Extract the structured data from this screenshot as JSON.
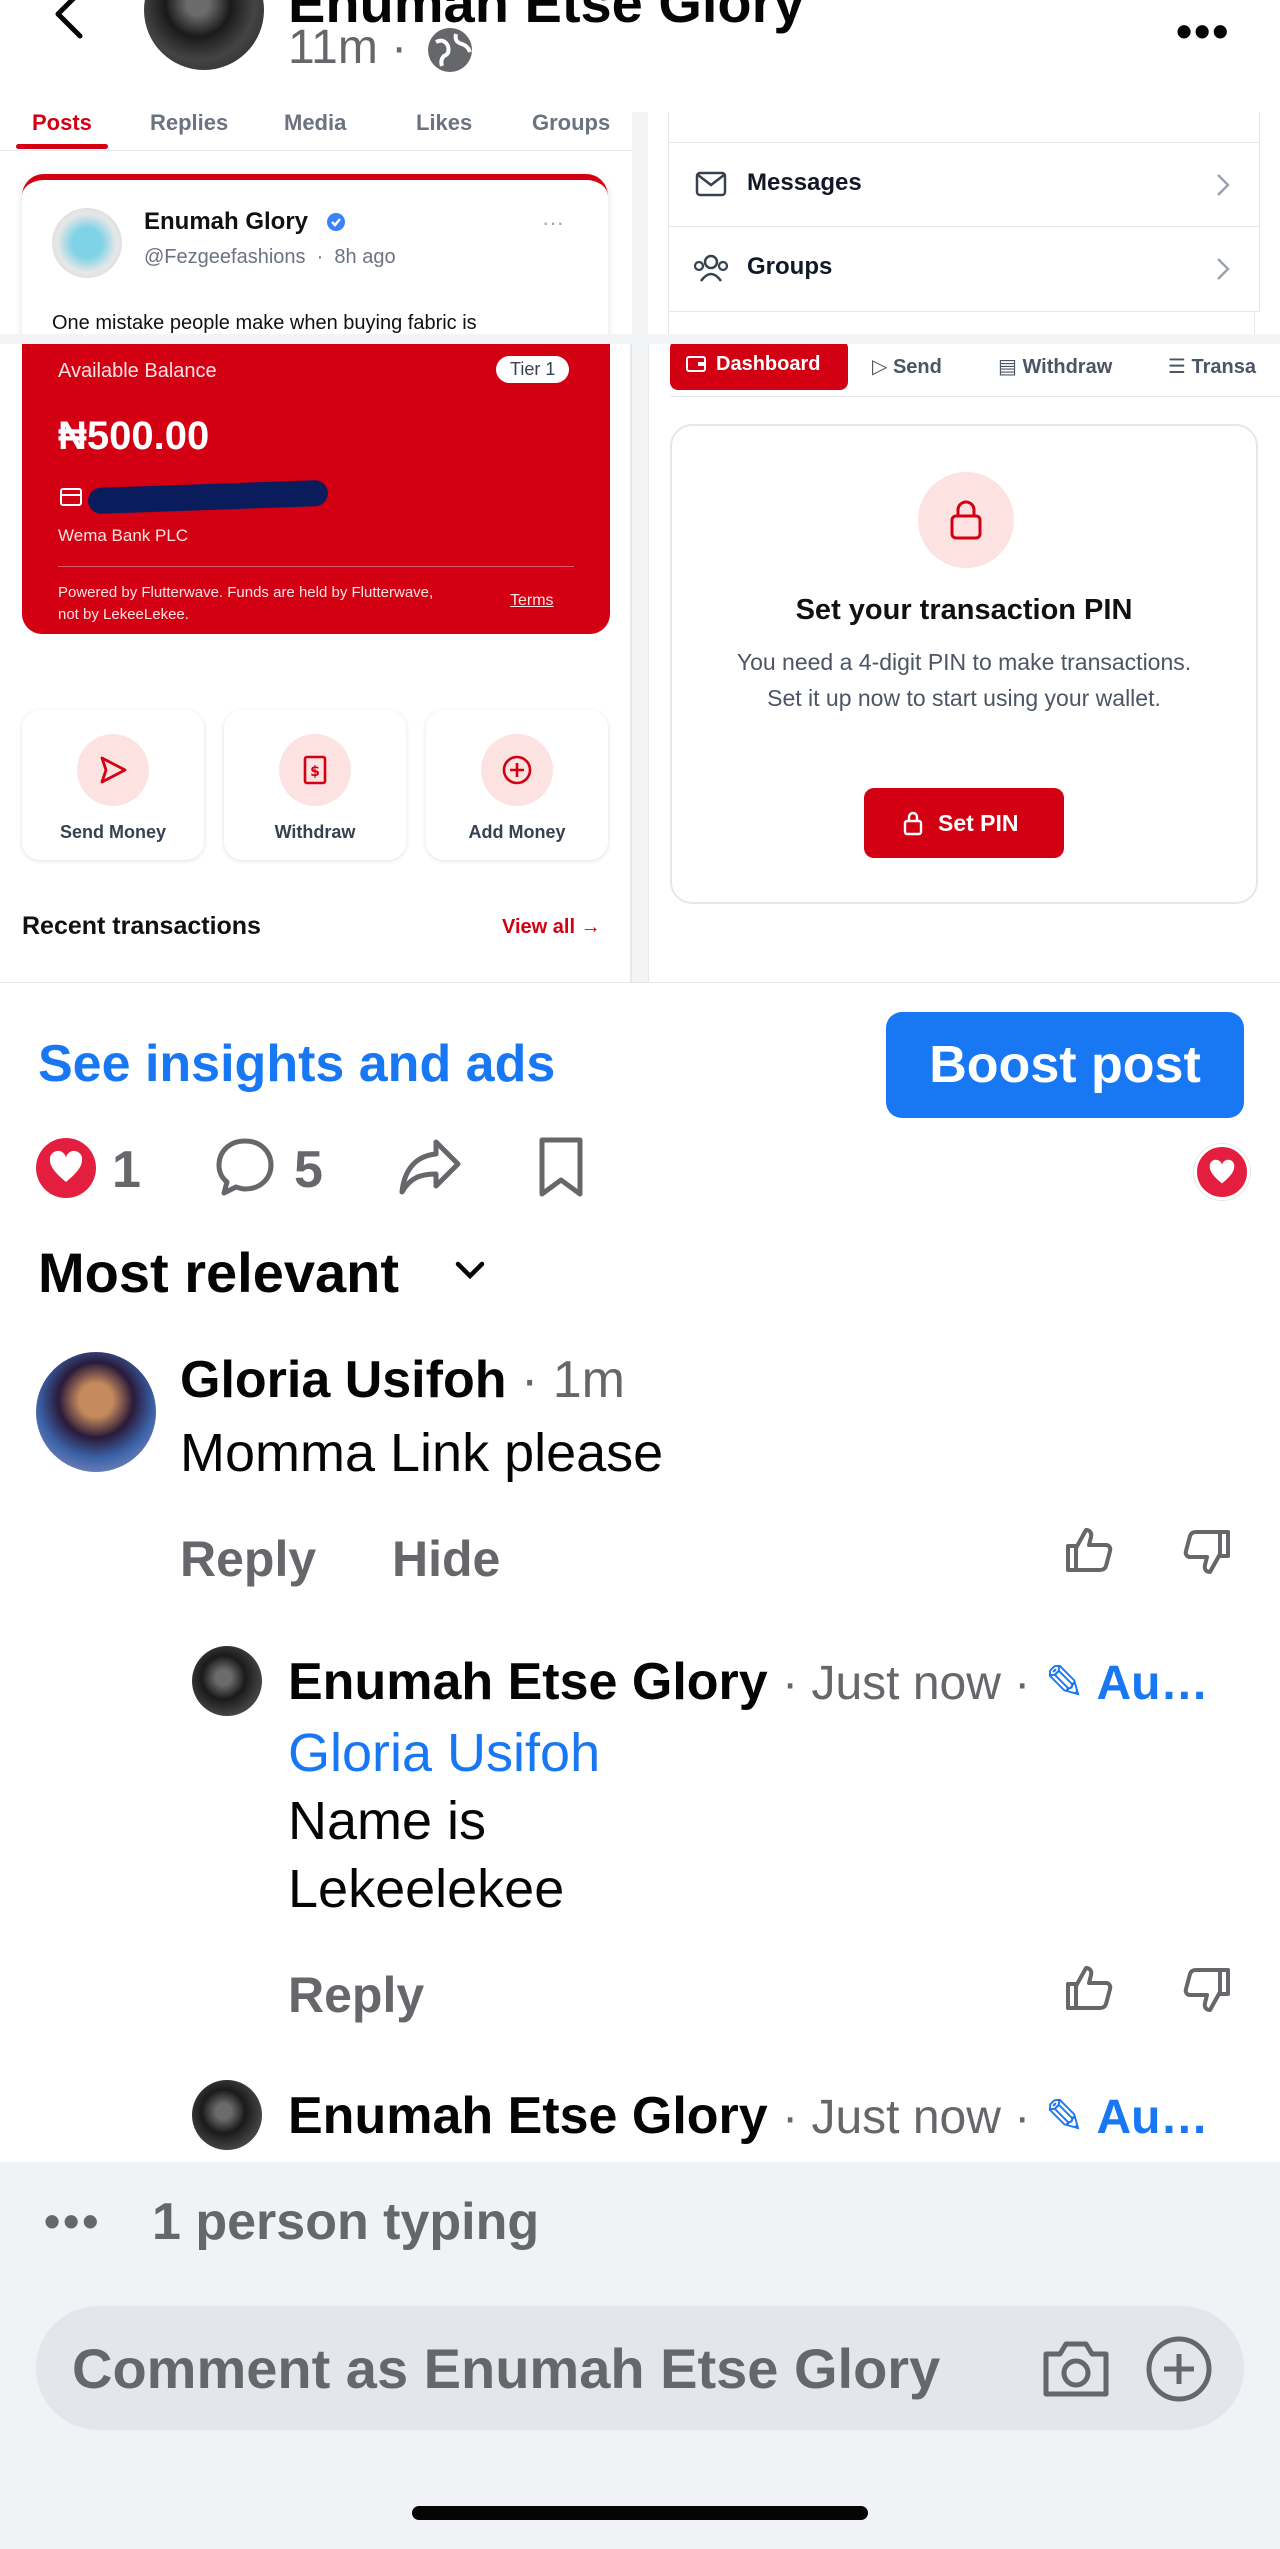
{
  "header": {
    "author_name": "Enumah Etse Glory",
    "post_age": "11m ·"
  },
  "screenshot": {
    "profile_tabs": [
      "Posts",
      "Replies",
      "Media",
      "Likes",
      "Groups"
    ],
    "post_card": {
      "name": "Enumah Glory",
      "handle": "@Fezgeefashions",
      "age": "8h ago",
      "snippet": "One mistake people make when buying fabric is"
    },
    "menu_items": [
      "Messages",
      "Groups"
    ],
    "wallet": {
      "balance_label": "Available Balance",
      "tier": "Tier 1",
      "balance": "₦500.00",
      "bank": "Wema Bank PLC",
      "powered_by": "Powered by Flutterwave. Funds are held by Flutterwave, not by LekeeLekee.",
      "terms": "Terms"
    },
    "actions": [
      "Send Money",
      "Withdraw",
      "Add Money"
    ],
    "recent_title": "Recent transactions",
    "view_all": "View all",
    "wallet_tabs": [
      "Dashboard",
      "Send",
      "Withdraw",
      "Transa"
    ],
    "pin_card": {
      "title": "Set your transaction PIN",
      "body": "You need a 4-digit PIN to make transactions. Set it up now to start using your wallet.",
      "button": "Set PIN"
    }
  },
  "post_actions": {
    "insights": "See insights and ads",
    "boost": "Boost post",
    "likes": "1",
    "comments": "5"
  },
  "sort_label": "Most relevant",
  "comments": [
    {
      "author": "Gloria Usifoh",
      "age": "· 1m",
      "text": "Momma Link please",
      "reply": "Reply",
      "hide": "Hide"
    }
  ],
  "replies": [
    {
      "author": "Enumah Etse Glory",
      "meta": "· Just now ·",
      "badge": "Au…",
      "mention": "Gloria Usifoh",
      "text_line1": "Name is",
      "text_line2": "Lekeelekee",
      "reply": "Reply"
    },
    {
      "author": "Enumah Etse Glory",
      "meta": "· Just now ·",
      "badge": "Au…"
    }
  ],
  "typing": "1 person typing",
  "composer": {
    "placeholder": "Comment as Enumah Etse Glory"
  },
  "colors": {
    "facebook_blue": "#1877f2",
    "wallet_red": "#d20012",
    "like_red": "#e41e3f"
  }
}
